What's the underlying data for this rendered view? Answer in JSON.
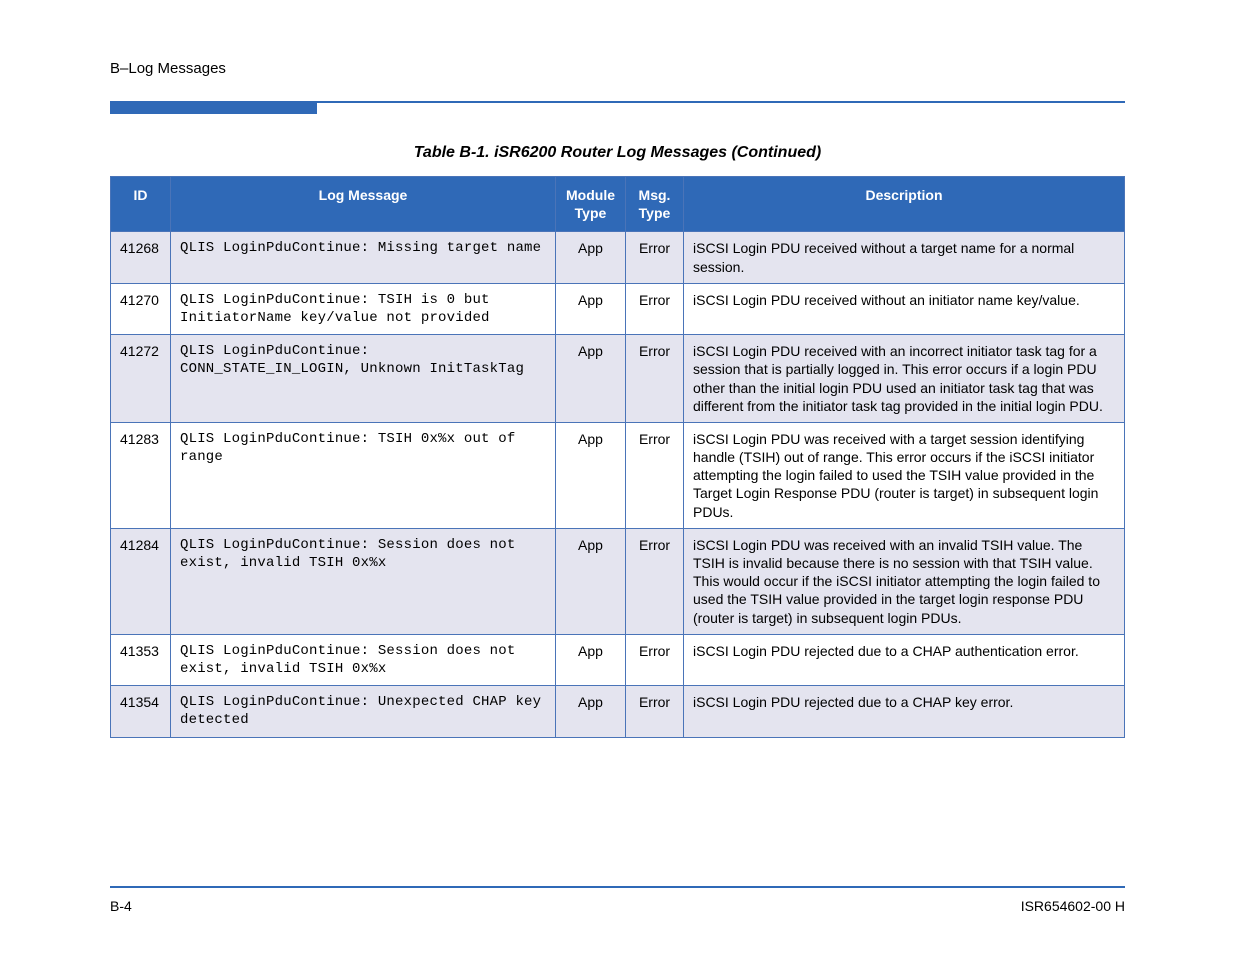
{
  "section_header": "B–Log Messages",
  "table_title": "Table B-1. iSR6200 Router Log Messages (Continued)",
  "columns": {
    "id": "ID",
    "log_message": "Log Message",
    "module_type": "Module Type",
    "msg_type": "Msg. Type",
    "description": "Description"
  },
  "rows": [
    {
      "id": "41268",
      "log_message": "QLIS LoginPduContinue: Missing target name",
      "module_type": "App",
      "msg_type": "Error",
      "description": "iSCSI Login PDU received without a target name for a normal session."
    },
    {
      "id": "41270",
      "log_message": "QLIS LoginPduContinue: TSIH is 0 but InitiatorName key/value not provided",
      "module_type": "App",
      "msg_type": "Error",
      "description": "iSCSI Login PDU received without an initiator name key/value."
    },
    {
      "id": "41272",
      "log_message": "QLIS LoginPduContinue: CONN_STATE_IN_LOGIN, Unknown InitTaskTag",
      "module_type": "App",
      "msg_type": "Error",
      "description": "iSCSI Login PDU received with an incorrect initiator task tag for a session that is partially logged in. This error occurs if a login PDU other than the initial login PDU used an initiator task tag that was different from the initiator task tag provided in the initial login PDU."
    },
    {
      "id": "41283",
      "log_message": "QLIS LoginPduContinue: TSIH 0x%x out of range",
      "module_type": "App",
      "msg_type": "Error",
      "description": "iSCSI Login PDU was received with a target session identifying handle (TSIH) out of range. This error occurs if the iSCSI initiator attempting the login failed to used the TSIH value provided in the Target Login Response PDU (router is target) in subsequent login PDUs."
    },
    {
      "id": "41284",
      "log_message": "QLIS LoginPduContinue: Session does not exist, invalid TSIH 0x%x",
      "module_type": "App",
      "msg_type": "Error",
      "description": "iSCSI Login PDU was received with an invalid TSIH value. The TSIH is invalid because there is no session with that TSIH value. This would occur if the iSCSI initiator attempting the login failed to used the TSIH value provided in the target login response PDU (router is target) in subsequent login PDUs."
    },
    {
      "id": "41353",
      "log_message": "QLIS LoginPduContinue: Session does not exist, invalid TSIH 0x%x",
      "module_type": "App",
      "msg_type": "Error",
      "description": "iSCSI Login PDU rejected due to a CHAP authentication error."
    },
    {
      "id": "41354",
      "log_message": "QLIS LoginPduContinue: Unexpected CHAP key detected",
      "module_type": "App",
      "msg_type": "Error",
      "description": "iSCSI Login PDU rejected due to a CHAP key error."
    }
  ],
  "footer": {
    "left": "B-4",
    "right": "ISR654602-00  H"
  }
}
